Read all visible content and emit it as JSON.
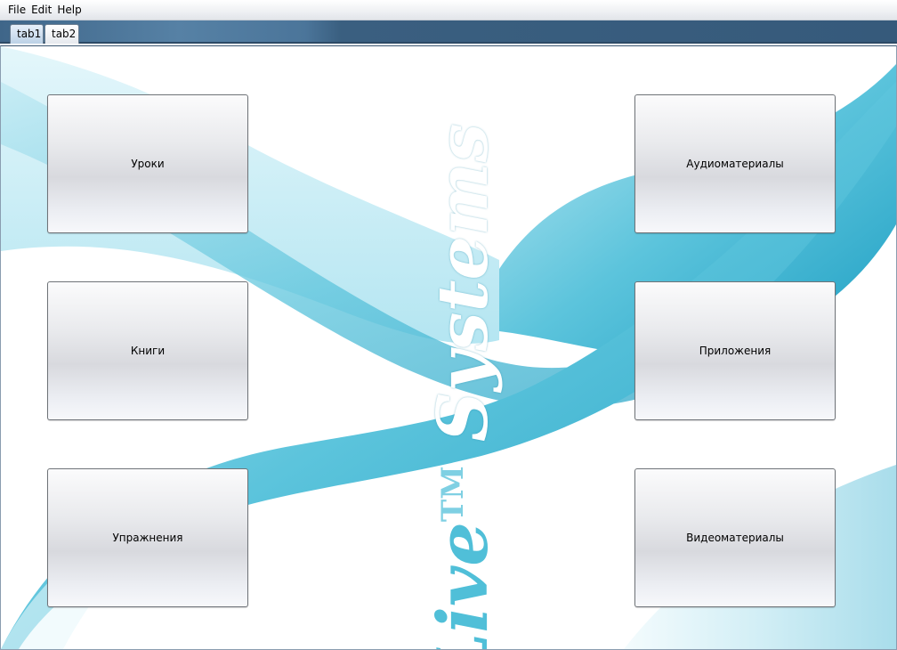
{
  "menu": {
    "file": "File",
    "edit": "Edit",
    "help": "Help"
  },
  "tabs": [
    {
      "label": "tab1",
      "active": true
    },
    {
      "label": "tab2",
      "active": false
    }
  ],
  "tiles": {
    "lessons": "Уроки",
    "books": "Книги",
    "exercises": "Упражнения",
    "audio": "Аудиоматериалы",
    "apps": "Приложения",
    "video": "Видеоматериалы"
  },
  "logo": {
    "live": "Live",
    "tm": "TM",
    "systems": "Systems"
  },
  "colors": {
    "accent": "#4fbcd6",
    "wave_dark": "#1fa3c6",
    "tabstrip": "#3a5f80"
  }
}
